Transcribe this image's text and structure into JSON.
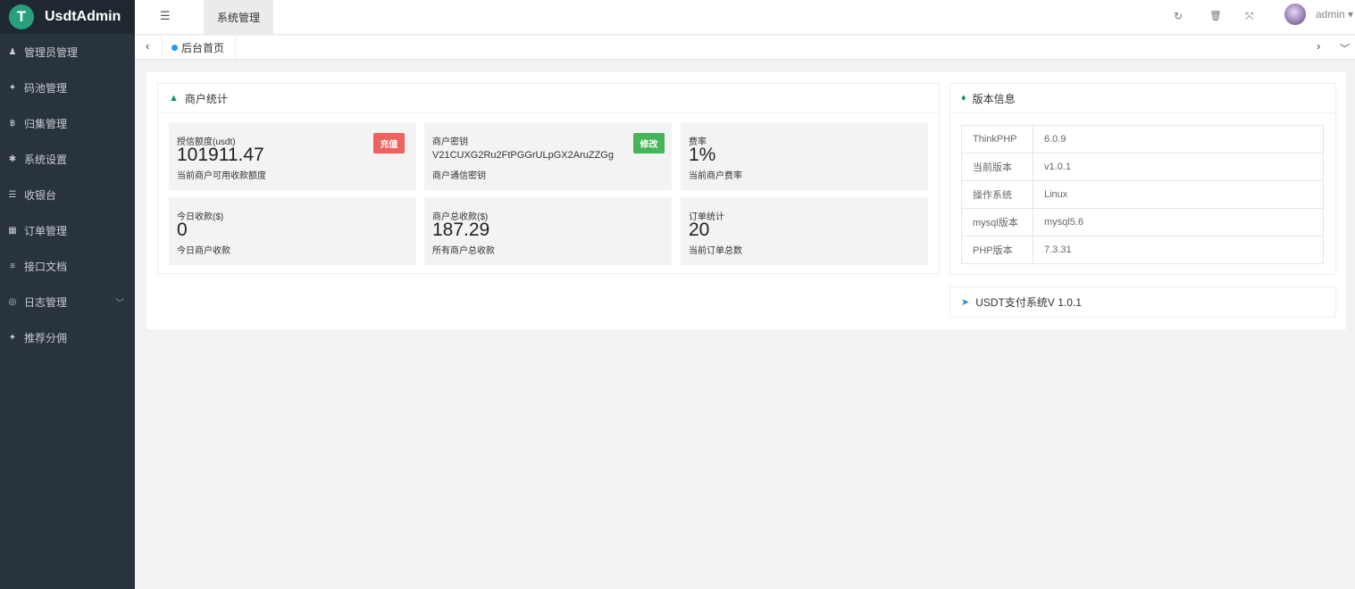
{
  "brand": {
    "name": "UsdtAdmin",
    "logo_letter": "T"
  },
  "sidebar": {
    "items": [
      {
        "label": "管理员管理",
        "icon": "user-icon",
        "glyph": "♟"
      },
      {
        "label": "码池管理",
        "icon": "android-icon",
        "glyph": "✦"
      },
      {
        "label": "归集管理",
        "icon": "bitcoin-icon",
        "glyph": "฿"
      },
      {
        "label": "系统设置",
        "icon": "gear-icon",
        "glyph": "✱"
      },
      {
        "label": "收银台",
        "icon": "list-icon",
        "glyph": "☰"
      },
      {
        "label": "订单管理",
        "icon": "calculator-icon",
        "glyph": "▦"
      },
      {
        "label": "接口文档",
        "icon": "doc-icon",
        "glyph": "≡"
      },
      {
        "label": "日志管理",
        "icon": "log-icon",
        "glyph": "◎",
        "chevron": "﹀"
      },
      {
        "label": "推荐分佣",
        "icon": "android-icon",
        "glyph": "✦"
      }
    ]
  },
  "header": {
    "menu_glyph": "☰",
    "tab_label": "系统管理",
    "refresh_glyph": "↻",
    "trash_glyph": "🗑",
    "fullscreen_glyph": "⤧",
    "username": "admin ▾"
  },
  "tabbar": {
    "prev": "‹",
    "next": "›",
    "more": "﹀",
    "home_label": "后台首页"
  },
  "merchant": {
    "title": "商户统计",
    "stats": [
      {
        "label": "授信额度(usdt)",
        "value": "101911.47",
        "desc": "当前商户可用收款额度",
        "badge": "充值"
      },
      {
        "label": "商户密钥",
        "key": "V21CUXG2Ru2FtPGGrULpGX2AruZZGg",
        "desc": "商户通信密钥",
        "badge": "修改"
      },
      {
        "label": "费率",
        "value": "1%",
        "desc": "当前商户费率"
      },
      {
        "label": "今日收款($)",
        "value": "0",
        "desc": "今日商户收款"
      },
      {
        "label": "商户总收款($)",
        "value": "187.29",
        "desc": "所有商户总收款"
      },
      {
        "label": "订单统计",
        "value": "20",
        "desc": "当前订单总数"
      }
    ]
  },
  "version": {
    "title": "版本信息",
    "rows": [
      {
        "key": "ThinkPHP",
        "value": "6.0.9"
      },
      {
        "key": "当前版本",
        "value": "v1.0.1"
      },
      {
        "key": "操作系统",
        "value": "Linux"
      },
      {
        "key": "mysql版本",
        "value": "mysql5.6"
      },
      {
        "key": "PHP版本",
        "value": "7.3.31"
      }
    ]
  },
  "footer_card": {
    "title": "USDT支付系统V 1.0.1"
  },
  "colors": {
    "sidebar": "#28333e",
    "accent": "#1e9fff",
    "red": "#f0625f",
    "green": "#45b45a",
    "usdt": "#26a17b"
  }
}
